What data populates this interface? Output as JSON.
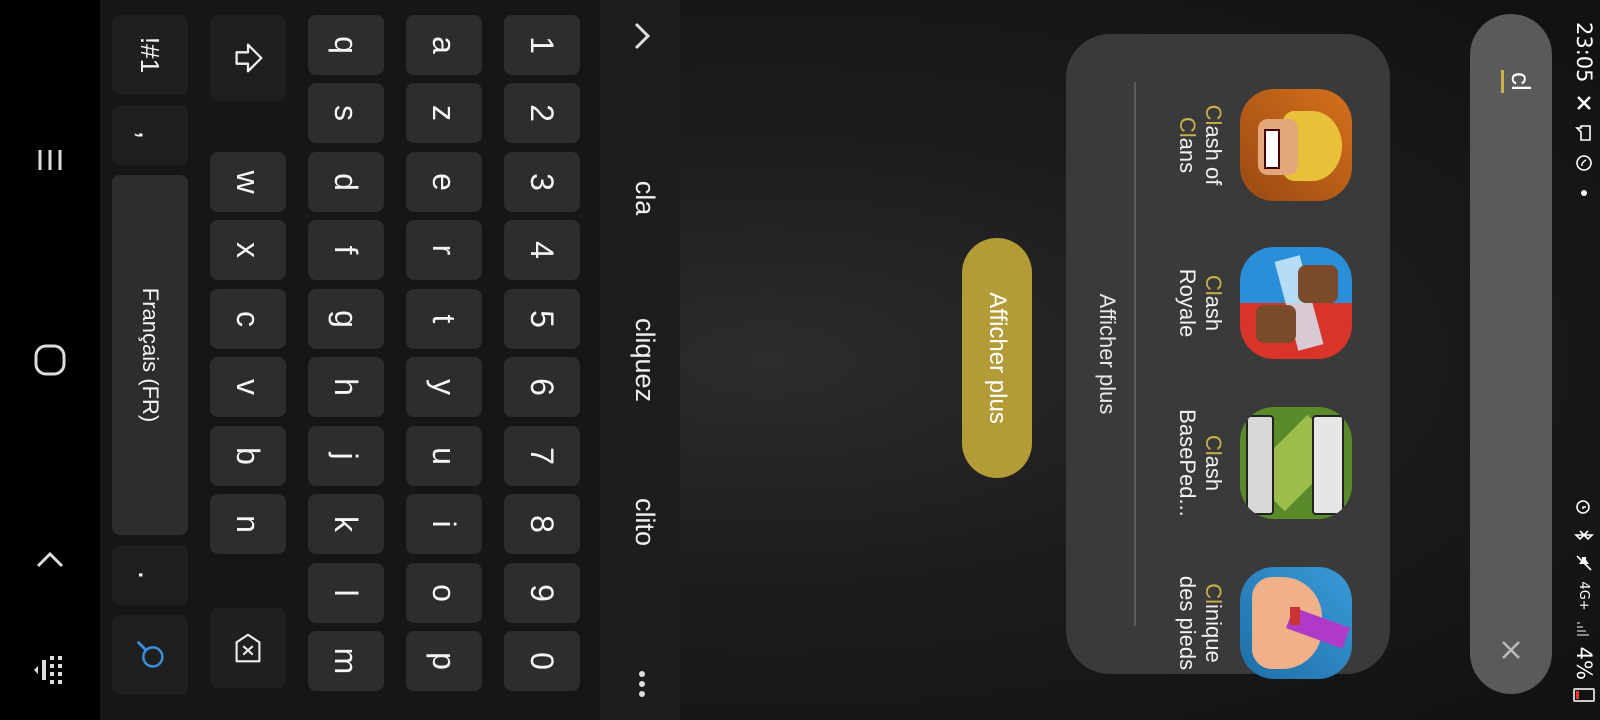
{
  "status": {
    "time": "23:05",
    "battery": "4%",
    "network": "4G+"
  },
  "search": {
    "query": "cl"
  },
  "results": {
    "apps": [
      {
        "highlight": "Cl",
        "rest": "ash of",
        "line2": "Clans",
        "line2_hl": "Cl",
        "line2_rest": "ans"
      },
      {
        "highlight": "Cl",
        "rest": "ash",
        "line2": "Royale"
      },
      {
        "highlight": "Cl",
        "rest": "ash",
        "line2": "BasePed..."
      },
      {
        "highlight": "Cl",
        "rest": "inique",
        "line2": "des pieds"
      }
    ],
    "more_label": "Afficher plus"
  },
  "show_more_button": {
    "label": "Afficher plus"
  },
  "keyboard": {
    "suggestions": [
      "cla",
      "cliquez",
      "clito"
    ],
    "number_row": [
      "1",
      "2",
      "3",
      "4",
      "5",
      "6",
      "7",
      "8",
      "9",
      "0"
    ],
    "row1": [
      "a",
      "z",
      "e",
      "r",
      "t",
      "y",
      "u",
      "i",
      "o",
      "p"
    ],
    "row2": [
      "q",
      "s",
      "d",
      "f",
      "g",
      "h",
      "j",
      "k",
      "l",
      "m"
    ],
    "row3": [
      "w",
      "x",
      "c",
      "v",
      "b",
      "n"
    ],
    "symbols_label": "!#1",
    "comma_label": ",",
    "space_label": "Français (FR)",
    "period_label": "."
  },
  "colors": {
    "accent": "#c9b04a",
    "button": "#b39b38",
    "key": "#2d2d2d",
    "card": "#3a3a3a"
  }
}
